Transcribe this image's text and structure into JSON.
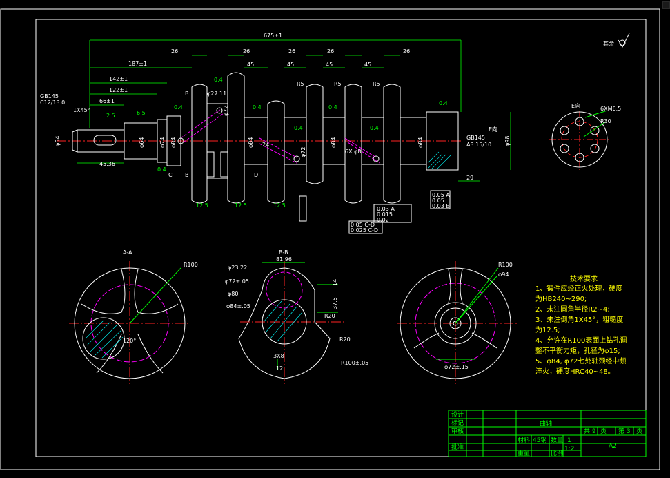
{
  "colors": {
    "background": "#000000",
    "dimension": "#00ff00",
    "outline": "#ffffff",
    "center": "#ff2222",
    "hidden": "#ff00ff",
    "hatch": "#00ffff",
    "notes": "#ffff00"
  },
  "main_view": {
    "overall_length": "675±1",
    "dims_left": [
      "187±1",
      "142±1",
      "122±1",
      "66±1",
      "45.36"
    ],
    "widths": [
      "26",
      "26",
      "26",
      "26",
      "26"
    ],
    "journal_widths": [
      "45",
      "45",
      "45",
      "45"
    ],
    "chamfer": "1X45°",
    "roughness": [
      "0.4",
      "0.4",
      "0.4",
      "0.4",
      "0.4",
      "0.4",
      "0.4",
      "12.5",
      "12.5",
      "12.5",
      "6.5",
      "2.5"
    ],
    "fillets": [
      "R5",
      "R5",
      "R5"
    ],
    "diameters_vert": [
      "φ54",
      "φ64",
      "φ74",
      "φ84",
      "φ84",
      "φ84",
      "φ84",
      "φ72",
      "φ72",
      "φ98"
    ],
    "holes": "6X φ8",
    "ref_left_1": "GB145",
    "ref_left_2": "C12/13.0",
    "ref_right_1": "GB145",
    "ref_right_2": "A3.15/10",
    "section_b": "B",
    "section_c": "C",
    "section_d": "D",
    "end_label": "E向",
    "right_dims": [
      "29"
    ],
    "gdt": [
      "0.05 A",
      "0.05",
      "0.05",
      "0.03 A",
      "0.015",
      "0.05 C-D",
      "0.02",
      "0.025 C-D",
      "0.03 B"
    ],
    "angle_marks": [
      "φ27.11",
      "30°",
      "24"
    ]
  },
  "end_view": {
    "title": "E向",
    "holes": "6XM6.5",
    "radius": "R30"
  },
  "roughness_mark": "其余",
  "section_aa": {
    "title": "A-A",
    "radius": "R100",
    "angle": "120°"
  },
  "section_bb": {
    "title": "B-B",
    "dims": [
      "φ23.22",
      "81.96",
      "φ72±.05",
      "φ80",
      "φ84±.05",
      "14",
      "37.5",
      "R20",
      "R20",
      "3X8",
      "12",
      "R100±.05"
    ]
  },
  "section_c": {
    "radius": "R100",
    "dia": "φ94",
    "dia2": "φ72±.15"
  },
  "tech_notes": {
    "heading": "技术要求",
    "lines": [
      "1、锻件应经正火处理，硬度",
      "为HB240~290;",
      "2、未注圆角半径R2~4;",
      "3、未注倒角1X45°，粗糙度",
      "为12.5;",
      "4、允许在R100表面上钻孔调",
      "整不平衡力矩，孔径为φ15;",
      "5、φ84, φ72七处轴颈经中频",
      "淬火，硬度HRC40~48。"
    ]
  },
  "title_block": {
    "part_name": "曲轴",
    "sheet": [
      "共 9",
      "页",
      "第 3",
      "页"
    ],
    "scale": "1",
    "scale2": "1:2",
    "size": "A2",
    "row_labels": [
      "设计",
      "审核",
      "批准",
      "标记"
    ],
    "cells": [
      "材料",
      "45钢",
      "数量",
      "重量",
      "比例"
    ]
  }
}
